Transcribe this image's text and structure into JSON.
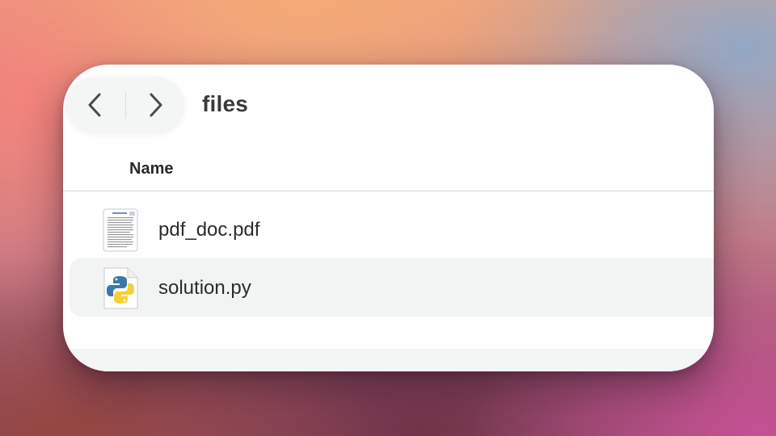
{
  "window": {
    "title": "files",
    "icons": {
      "back": "chevron-left-icon",
      "forward": "chevron-right-icon"
    }
  },
  "columns": {
    "name": "Name"
  },
  "files": [
    {
      "name": "pdf_doc.pdf",
      "icon": "pdf-document-icon",
      "selected": false
    },
    {
      "name": "solution.py",
      "icon": "python-file-icon",
      "selected": true
    }
  ]
}
